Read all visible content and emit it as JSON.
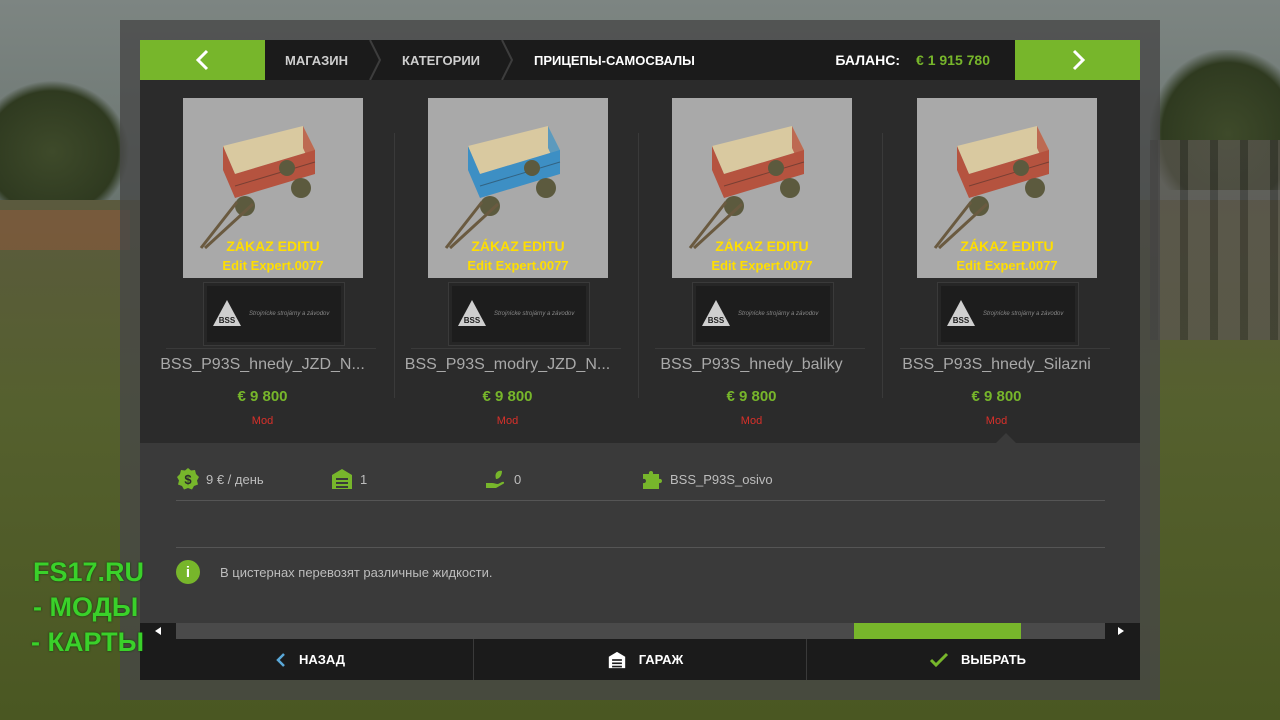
{
  "header": {
    "breadcrumbs": [
      "МАГАЗИН",
      "КАТЕГОРИИ",
      "ПРИЦЕПЫ-САМОСВАЛЫ"
    ],
    "balance_label": "БАЛАНС:",
    "balance_value": "€ 1 915 780",
    "prev_icon": "chevron-left-icon",
    "next_icon": "chevron-right-icon"
  },
  "items": [
    {
      "name": "BSS_P93S_hnedy_JZD_N...",
      "price": "€ 9 800",
      "tag": "Mod",
      "overlay1": "ZÁKAZ EDITU",
      "overlay2": "Edit Expert.0077",
      "body_color": "#b5533f"
    },
    {
      "name": "BSS_P93S_modry_JZD_N...",
      "price": "€ 9 800",
      "tag": "Mod",
      "overlay1": "ZÁKAZ EDITU",
      "overlay2": "Edit Expert.0077",
      "body_color": "#3d8fc4"
    },
    {
      "name": "BSS_P93S_hnedy_baliky",
      "price": "€ 9 800",
      "tag": "Mod",
      "overlay1": "ZÁKAZ EDITU",
      "overlay2": "Edit Expert.0077",
      "body_color": "#b5533f"
    },
    {
      "name": "BSS_P93S_hnedy_Silazni",
      "price": "€ 9 800",
      "tag": "Mod",
      "overlay1": "ZÁKAZ EDITU",
      "overlay2": "Edit Expert.0077",
      "body_color": "#b5533f"
    }
  ],
  "logo_text": "Strojnícke strojárny a závodov",
  "details": {
    "upkeep": "9 € / день",
    "garage_count": "1",
    "capacity": "0",
    "mod_name": "BSS_P93S_osivo",
    "description": "В цистернах перевозят различные жидкости."
  },
  "scroll": {
    "thumb_start": 0.73,
    "thumb_end": 0.91
  },
  "buttons": {
    "back": "НАЗАД",
    "garage": "ГАРАЖ",
    "select": "ВЫБРАТЬ"
  },
  "watermark": [
    "FS17.RU",
    "- МОДЫ",
    "- КАРТЫ"
  ],
  "colors": {
    "accent": "#77b62b",
    "mod_tag": "#d9302a"
  }
}
